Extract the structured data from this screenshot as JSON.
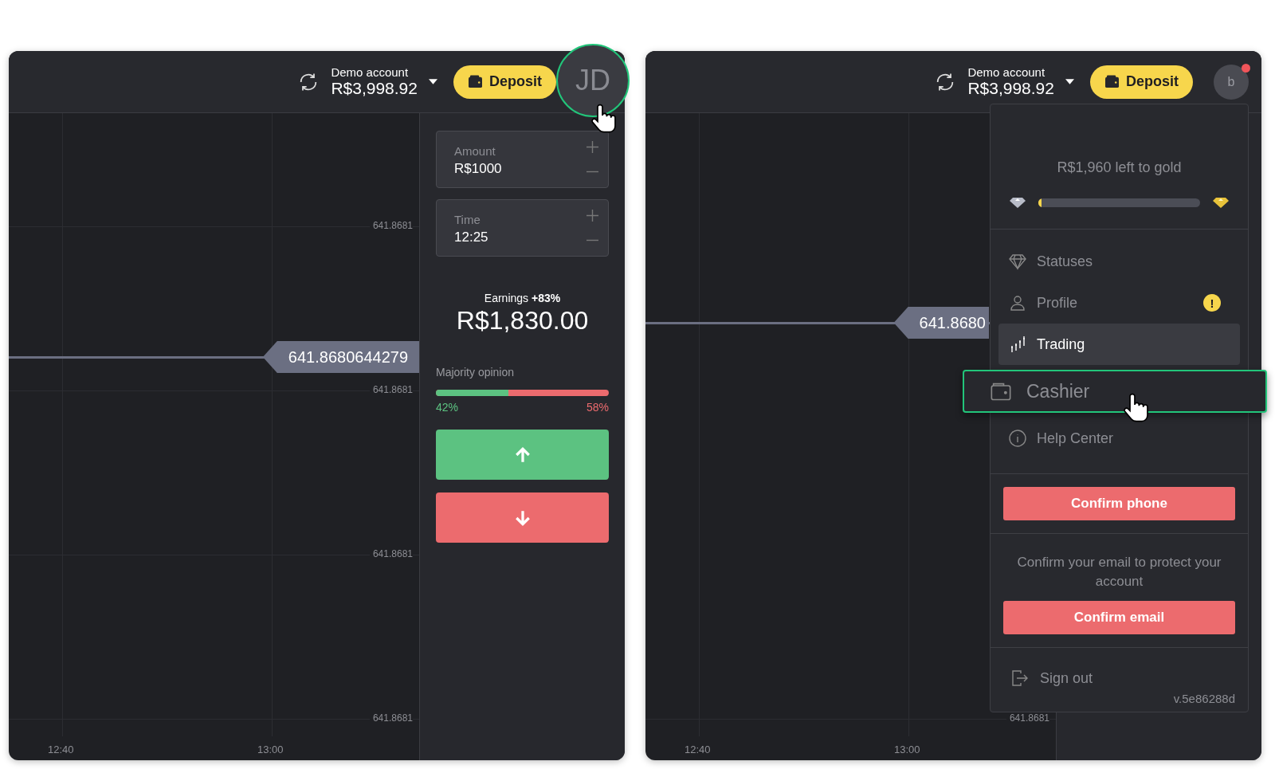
{
  "panels": [
    {
      "header": {
        "account_label": "Demo account",
        "balance": "R$3,998.92",
        "deposit": "Deposit",
        "avatar": {
          "initials": "JD",
          "highlighted": true,
          "notification": false,
          "pointer": true
        }
      },
      "chart": {
        "price_tag": "641.8680644279",
        "y_labels": [
          "641.8681",
          "641.8681",
          "641.8681",
          "641.8681"
        ],
        "x_labels": [
          "12:40",
          "13:00"
        ]
      },
      "trade_panel": {
        "fields": [
          {
            "label": "Amount",
            "value": "R$1000"
          },
          {
            "label": "Time",
            "value": "12:25"
          }
        ],
        "earnings": {
          "label": "Earnings",
          "percent": "+83%",
          "amount": "R$1,830.00"
        },
        "majority": {
          "label": "Majority opinion",
          "level": 0.42,
          "up": "42%",
          "down": "58%"
        },
        "trade_buttons": [
          {
            "kind": "up"
          },
          {
            "kind": "down"
          }
        ]
      }
    },
    {
      "header": {
        "account_label": "Demo account",
        "balance": "R$3,998.92",
        "deposit": "Deposit",
        "avatar": {
          "initials": "b",
          "highlighted": false,
          "notification": true,
          "pointer": false
        }
      },
      "chart": {
        "price_tag": "641.8680",
        "y_labels": [
          "641.8681"
        ],
        "x_labels": [
          "12:40",
          "13:00"
        ]
      },
      "menu": {
        "status_text": "R$1,960 left to gold",
        "level": 0.02,
        "items": [
          {
            "kind": "statuses",
            "label": "Statuses",
            "selected": false,
            "highlighted": false,
            "pointer": false
          },
          {
            "kind": "profile",
            "label": "Profile",
            "badge": "!",
            "selected": false,
            "highlighted": false,
            "pointer": false
          },
          {
            "kind": "trading",
            "label": "Trading",
            "selected": true,
            "highlighted": false,
            "pointer": false
          },
          {
            "kind": "cashier",
            "label": "Cashier",
            "selected": false,
            "highlighted": true,
            "pointer": true
          },
          {
            "kind": "help",
            "label": "Help Center",
            "selected": false,
            "highlighted": false,
            "pointer": false
          }
        ],
        "confirm_phone": "Confirm phone",
        "email_notice": "Confirm your email to protect your account",
        "confirm_email": "Confirm email",
        "sign_out": "Sign out",
        "version": "v.5e86288d"
      }
    }
  ]
}
